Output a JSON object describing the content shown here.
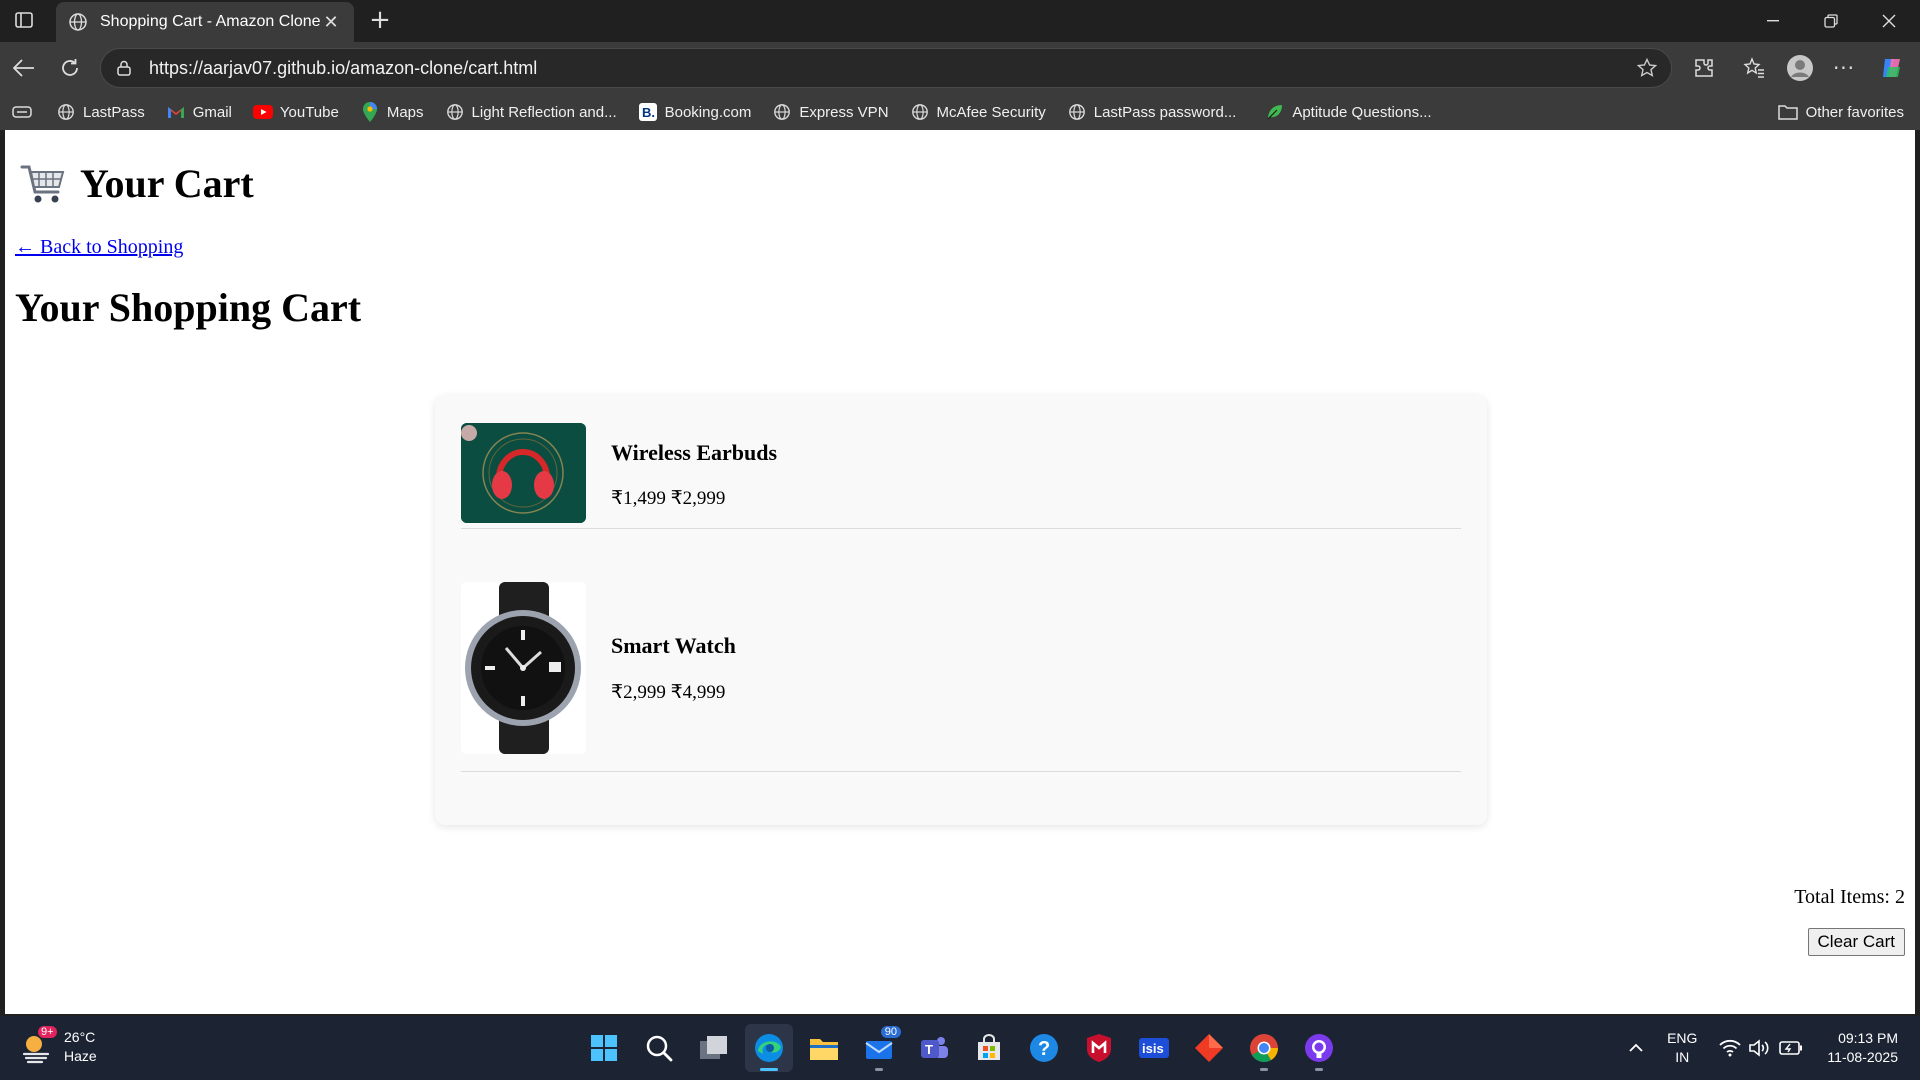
{
  "browser": {
    "tab_title": "Shopping Cart - Amazon Clone",
    "url": "https://aarjav07.github.io/amazon-clone/cart.html",
    "bookmarks": [
      {
        "label": "LastPass",
        "icon": "globe-icon"
      },
      {
        "label": "Gmail",
        "icon": "gmail-icon"
      },
      {
        "label": "YouTube",
        "icon": "youtube-icon"
      },
      {
        "label": "Maps",
        "icon": "maps-icon"
      },
      {
        "label": "Light Reflection and...",
        "icon": "globe-icon"
      },
      {
        "label": "Booking.com",
        "icon": "booking-icon"
      },
      {
        "label": "Express VPN",
        "icon": "globe-icon"
      },
      {
        "label": "McAfee Security",
        "icon": "globe-icon"
      },
      {
        "label": "LastPass password...",
        "icon": "globe-icon"
      },
      {
        "label": "Aptitude Questions...",
        "icon": "leaf-icon"
      }
    ],
    "other_favorites": "Other favorites"
  },
  "page": {
    "heading_icon": "🛒",
    "heading": "Your Cart",
    "back_link": "← Back to Shopping",
    "section_title": "Your Shopping Cart",
    "items": [
      {
        "name": "Wireless Earbuds",
        "price": "₹1,499 ₹2,999",
        "image": "red-headphones-image"
      },
      {
        "name": "Smart Watch",
        "price": "₹2,999 ₹4,999",
        "image": "black-watch-image"
      }
    ],
    "total_items": "Total Items: 2",
    "clear_button": "Clear Cart"
  },
  "taskbar": {
    "weather_temp": "26°C",
    "weather_desc": "Haze",
    "weather_badge": "9+",
    "mail_badge": "90",
    "language": "ENG",
    "region": "IN",
    "time": "09:13 PM",
    "date": "11-08-2025"
  },
  "colors": {
    "link": "#0000ee",
    "chrome_bg": "#202020",
    "toolbar_bg": "#3b3b3b",
    "taskbar_bg": "#1c2333",
    "cart_box_bg": "#f9f9f9"
  }
}
